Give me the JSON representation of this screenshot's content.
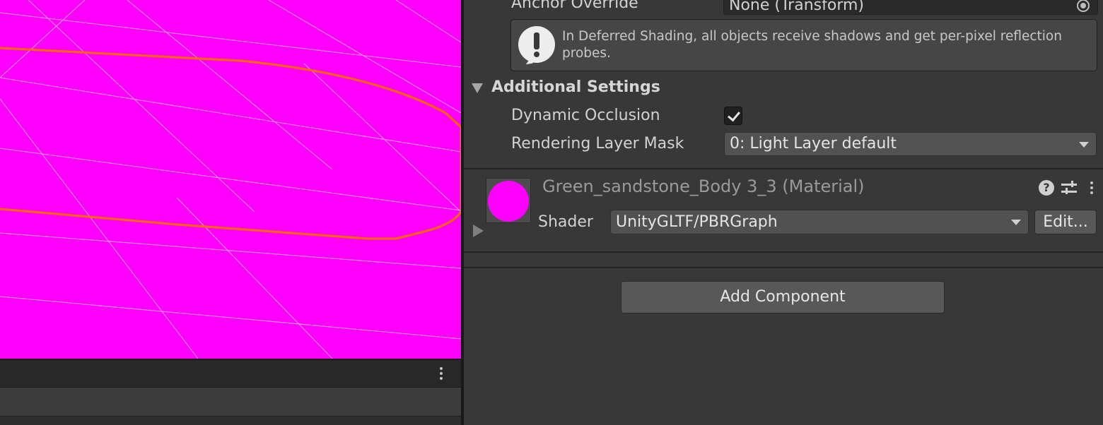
{
  "inspector": {
    "anchor_override": {
      "label": "Anchor Override",
      "value": "None (Transform)"
    },
    "help_box": {
      "text": "In Deferred Shading, all objects receive shadows and get per-pixel reflection probes."
    },
    "additional_settings": {
      "title": "Additional Settings",
      "dynamic_occlusion": {
        "label": "Dynamic Occlusion",
        "checked": true
      },
      "rendering_layer_mask": {
        "label": "Rendering Layer Mask",
        "value": "0: Light Layer default"
      }
    },
    "material": {
      "title": "Green_sandstone_Body 3_3 (Material)",
      "preview_color": "#ff00ff",
      "shader_label": "Shader",
      "shader_value": "UnityGLTF/PBRGraph",
      "edit_label": "Edit..."
    },
    "add_component_label": "Add Component"
  },
  "scene": {
    "background_color": "#ff00ff",
    "outline_color": "#ff6a00"
  }
}
